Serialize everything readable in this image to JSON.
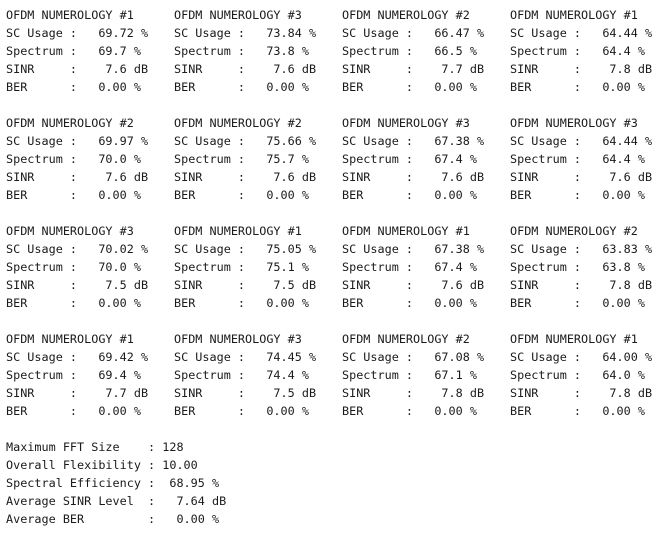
{
  "blocks": [
    {
      "title": "OFDM NUMEROLOGY #1",
      "sc": "69.72",
      "spectrum": "69.7",
      "sinr": "7.6",
      "ber": "0.00"
    },
    {
      "title": "OFDM NUMEROLOGY #3",
      "sc": "73.84",
      "spectrum": "73.8",
      "sinr": "7.6",
      "ber": "0.00"
    },
    {
      "title": "OFDM NUMEROLOGY #2",
      "sc": "66.47",
      "spectrum": "66.5",
      "sinr": "7.7",
      "ber": "0.00"
    },
    {
      "title": "OFDM NUMEROLOGY #1",
      "sc": "64.44",
      "spectrum": "64.4",
      "sinr": "7.8",
      "ber": "0.00"
    },
    {
      "title": "OFDM NUMEROLOGY #2",
      "sc": "69.97",
      "spectrum": "70.0",
      "sinr": "7.6",
      "ber": "0.00"
    },
    {
      "title": "OFDM NUMEROLOGY #2",
      "sc": "75.66",
      "spectrum": "75.7",
      "sinr": "7.6",
      "ber": "0.00"
    },
    {
      "title": "OFDM NUMEROLOGY #3",
      "sc": "67.38",
      "spectrum": "67.4",
      "sinr": "7.6",
      "ber": "0.00"
    },
    {
      "title": "OFDM NUMEROLOGY #3",
      "sc": "64.44",
      "spectrum": "64.4",
      "sinr": "7.6",
      "ber": "0.00"
    },
    {
      "title": "OFDM NUMEROLOGY #3",
      "sc": "70.02",
      "spectrum": "70.0",
      "sinr": "7.5",
      "ber": "0.00"
    },
    {
      "title": "OFDM NUMEROLOGY #1",
      "sc": "75.05",
      "spectrum": "75.1",
      "sinr": "7.5",
      "ber": "0.00"
    },
    {
      "title": "OFDM NUMEROLOGY #1",
      "sc": "67.38",
      "spectrum": "67.4",
      "sinr": "7.6",
      "ber": "0.00"
    },
    {
      "title": "OFDM NUMEROLOGY #2",
      "sc": "63.83",
      "spectrum": "63.8",
      "sinr": "7.8",
      "ber": "0.00"
    },
    {
      "title": "OFDM NUMEROLOGY #1",
      "sc": "69.42",
      "spectrum": "69.4",
      "sinr": "7.7",
      "ber": "0.00"
    },
    {
      "title": "OFDM NUMEROLOGY #3",
      "sc": "74.45",
      "spectrum": "74.4",
      "sinr": "7.5",
      "ber": "0.00"
    },
    {
      "title": "OFDM NUMEROLOGY #2",
      "sc": "67.08",
      "spectrum": "67.1",
      "sinr": "7.8",
      "ber": "0.00"
    },
    {
      "title": "OFDM NUMEROLOGY #1",
      "sc": "64.00",
      "spectrum": "64.0",
      "sinr": "7.8",
      "ber": "0.00"
    }
  ],
  "labels": {
    "sc": "SC Usage :",
    "spectrum": "Spectrum :",
    "sinr": "SINR     :",
    "ber": "BER      :",
    "percent": "%",
    "db": "dB"
  },
  "summary": [
    {
      "label": "Maximum FFT Size    :",
      "value": "128",
      "unit": ""
    },
    {
      "label": "Overall Flexibility :",
      "value": "10.00",
      "unit": ""
    },
    {
      "label": "Spectral Efficiency :",
      "value": "68.95",
      "unit": "%"
    },
    {
      "label": "Average SINR Level  :",
      "value": "7.64",
      "unit": "dB"
    },
    {
      "label": "Average BER         :",
      "value": "0.00",
      "unit": "%"
    }
  ]
}
